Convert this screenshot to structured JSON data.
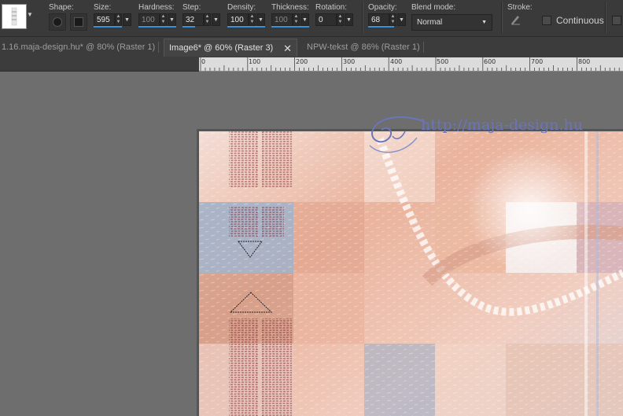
{
  "toolbar": {
    "shape_label": "Shape:",
    "size_label": "Size:",
    "size_value": "595",
    "hardness_label": "Hardness:",
    "hardness_value": "100",
    "step_label": "Step:",
    "step_value": "32",
    "density_label": "Density:",
    "density_value": "100",
    "thickness_label": "Thickness:",
    "thickness_value": "100",
    "rotation_label": "Rotation:",
    "rotation_value": "0",
    "opacity_label": "Opacity:",
    "opacity_value": "68",
    "blend_label": "Blend mode:",
    "blend_value": "Normal",
    "stroke_label": "Stroke:",
    "continuous_label": "Continuous"
  },
  "tabs": [
    {
      "label": "1.16.maja-design.hu* @  80% (Raster 1)",
      "active": false
    },
    {
      "label": "Image6* @  60% (Raster 3)",
      "active": true,
      "close": "✕"
    },
    {
      "label": "NPW-tekst @  86% (Raster 1)",
      "active": false
    }
  ],
  "ruler": {
    "labels": [
      "0",
      "100",
      "200",
      "300",
      "400",
      "500",
      "600",
      "700",
      "800"
    ]
  },
  "canvas": {
    "watermark_text": "http://maja-design.hu"
  },
  "icons": {
    "shape_round": "round-brush-icon",
    "shape_square": "square-brush-icon",
    "stroke": "stroke-pen-icon",
    "tab_close": "close-icon"
  },
  "colors": {
    "accent": "#3f8fd6",
    "canvas_peach": "#eab8a2",
    "canvas_blue": "#9fb0c9",
    "watermark": "#6b75b8"
  }
}
